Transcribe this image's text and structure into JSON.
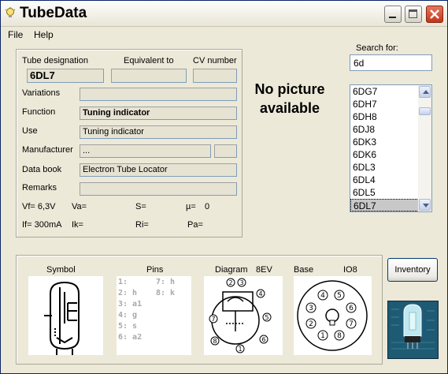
{
  "window": {
    "title": "TubeData"
  },
  "menu": [
    {
      "label": "File",
      "key": "F"
    },
    {
      "label": "Help",
      "key": "H"
    }
  ],
  "details": {
    "tube_designation_label": "Tube designation",
    "equivalent_label": "Equivalent to",
    "cv_label": "CV number",
    "tube_designation": "6DL7",
    "equivalent": "",
    "cv_number": "",
    "variations_label": "Variations",
    "variations": "",
    "function_label": "Function",
    "function": "Tuning indicator",
    "use_label": "Use",
    "use": "Tuning indicator",
    "manufacturer_label": "Manufacturer",
    "manufacturer": "...",
    "manufacturer_code": "",
    "databook_label": "Data book",
    "databook": "Electron Tube Locator",
    "remarks_label": "Remarks",
    "remarks": "",
    "vf": "Vf= 6,3V",
    "va": "Va=",
    "s": "S=",
    "mu": "µ=",
    "mu_value": "0",
    "if": "If= 300mA",
    "ik": "Ik=",
    "ri": "Ri=",
    "pa": "Pa="
  },
  "picture": {
    "placeholder": "No picture available"
  },
  "search": {
    "label": "Search for:",
    "value": "6d",
    "results": [
      "6DG7",
      "6DH7",
      "6DH8",
      "6DJ8",
      "6DK3",
      "6DK6",
      "6DL3",
      "6DL4",
      "6DL5",
      "6DL7"
    ],
    "selected": "6DL7"
  },
  "bottom": {
    "symbol_label": "Symbol",
    "pins_label": "Pins",
    "diagram_label": "Diagram",
    "diagram_code": "8EV",
    "base_label": "Base",
    "base_code": "IO8",
    "pins": [
      "1:",
      "2: h",
      "3: a1",
      "4: g",
      "5: s",
      "6: a2",
      "7: h",
      "8: k"
    ],
    "base_pin_numbers": [
      "1",
      "2",
      "3",
      "4",
      "5",
      "6",
      "7",
      "8"
    ],
    "diagram_pin_numbers": [
      "1",
      "2",
      "3",
      "4",
      "5",
      "6",
      "7",
      "8"
    ]
  },
  "inventory_button": "Inventory",
  "colors": {
    "title_close": "#c2351b",
    "panel_bg": "#ece9d8",
    "field_bg": "#e6e3d3",
    "pin_text": "#a8a8a8"
  }
}
